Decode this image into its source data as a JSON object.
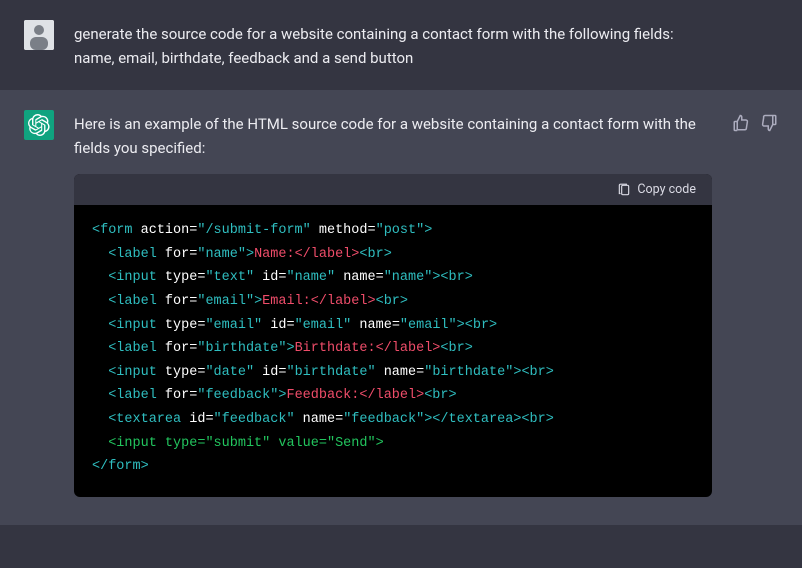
{
  "user": {
    "prompt_line1": "generate the source code for a website containing a contact form with the following fields:",
    "prompt_line2": "name, email, birthdate, feedback and a send button"
  },
  "assistant": {
    "intro": "Here is an example of the HTML source code for a website containing a contact form with the fields you specified:",
    "copy_label": "Copy code",
    "code": {
      "form_action": "\"/submit-form\"",
      "form_method": "\"post\"",
      "name_for": "\"name\"",
      "name_label": "Name:",
      "name_type": "\"text\"",
      "name_id": "\"name\"",
      "name_name": "\"name\"",
      "email_for": "\"email\"",
      "email_label": "Email:",
      "email_type": "\"email\"",
      "email_id": "\"email\"",
      "email_name": "\"email\"",
      "birth_for": "\"birthdate\"",
      "birth_label": "Birthdate:",
      "birth_type": "\"date\"",
      "birth_id": "\"birthdate\"",
      "birth_name": "\"birthdate\"",
      "fb_for": "\"feedback\"",
      "fb_label": "Feedback:",
      "fb_id": "\"feedback\"",
      "fb_name": "\"feedback\"",
      "submit_type": "\"submit\"",
      "submit_value": "\"Send\""
    }
  }
}
